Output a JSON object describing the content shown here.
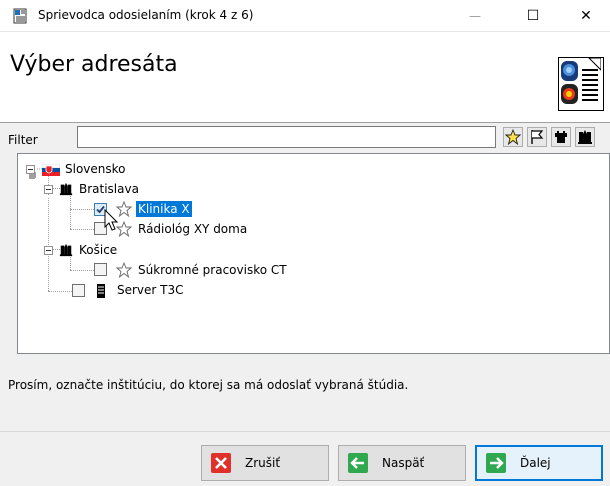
{
  "window": {
    "title": "Sprievodca odosielaním (krok 4 z 6)",
    "controls": {
      "minimize": "—",
      "maximize": "☐",
      "close": "✕"
    }
  },
  "header": {
    "title": "Výber adresáta",
    "logo_icon": "medical-scan-document-icon"
  },
  "filter": {
    "label": "Filter",
    "value": "",
    "placeholder": "",
    "buttons": [
      {
        "name": "favorites",
        "icon": "star-icon"
      },
      {
        "name": "flag",
        "icon": "flag-icon"
      },
      {
        "name": "tower",
        "icon": "castle-icon"
      },
      {
        "name": "institution",
        "icon": "building-icon"
      }
    ]
  },
  "tree": {
    "country": {
      "label": "Slovensko",
      "icon": "slovakia-flag-icon"
    },
    "bratislava": {
      "label": "Bratislava",
      "icon": "building-icon"
    },
    "klinika": {
      "label": "Klinika X",
      "checked": true,
      "icon": "star-icon"
    },
    "radiolog": {
      "label": "Rádiológ XY doma",
      "checked": false,
      "icon": "star-icon"
    },
    "kosice": {
      "label": "Košice",
      "icon": "building-icon"
    },
    "sukromne": {
      "label": "Súkromné pracovisko CT",
      "checked": false,
      "icon": "star-icon"
    },
    "server": {
      "label": "Server T3C",
      "checked": false,
      "icon": "server-icon"
    }
  },
  "message": "Prosím, označte inštitúciu, do ktorej sa má odoslať vybraná štúdia.",
  "buttons": {
    "cancel": "Zrušiť",
    "back": "Naspäť",
    "next": "Ďalej"
  },
  "colors": {
    "selection": "#0078d7",
    "cancel_icon": "#e0302a",
    "nav_icon": "#2fa84f"
  }
}
